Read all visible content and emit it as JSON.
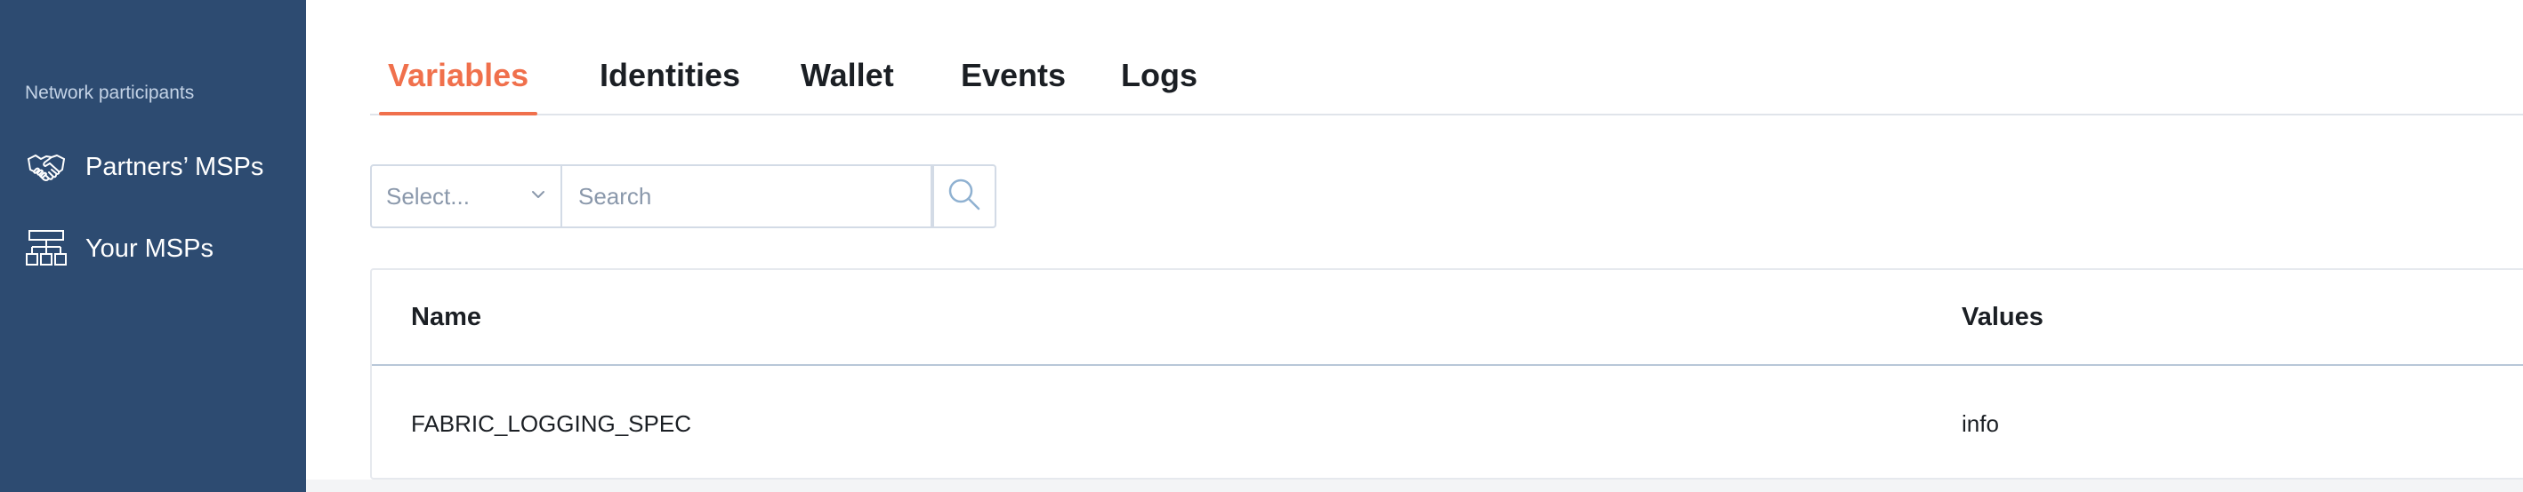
{
  "sidebar": {
    "section_label": "Network participants",
    "items": [
      {
        "label": "Partners’ MSPs",
        "icon": "handshake-icon"
      },
      {
        "label": "Your MSPs",
        "icon": "org-chart-icon"
      }
    ]
  },
  "tabs": [
    {
      "label": "Variables",
      "active": true
    },
    {
      "label": "Identities",
      "active": false
    },
    {
      "label": "Wallet",
      "active": false
    },
    {
      "label": "Events",
      "active": false
    },
    {
      "label": "Logs",
      "active": false
    }
  ],
  "filter": {
    "select_placeholder": "Select...",
    "search_placeholder": "Search"
  },
  "table": {
    "columns": [
      "Name",
      "Values"
    ],
    "rows": [
      [
        "FABRIC_LOGGING_SPEC",
        "info"
      ]
    ]
  },
  "colors": {
    "sidebar_bg": "#2d4b71",
    "accent": "#f0704c"
  }
}
